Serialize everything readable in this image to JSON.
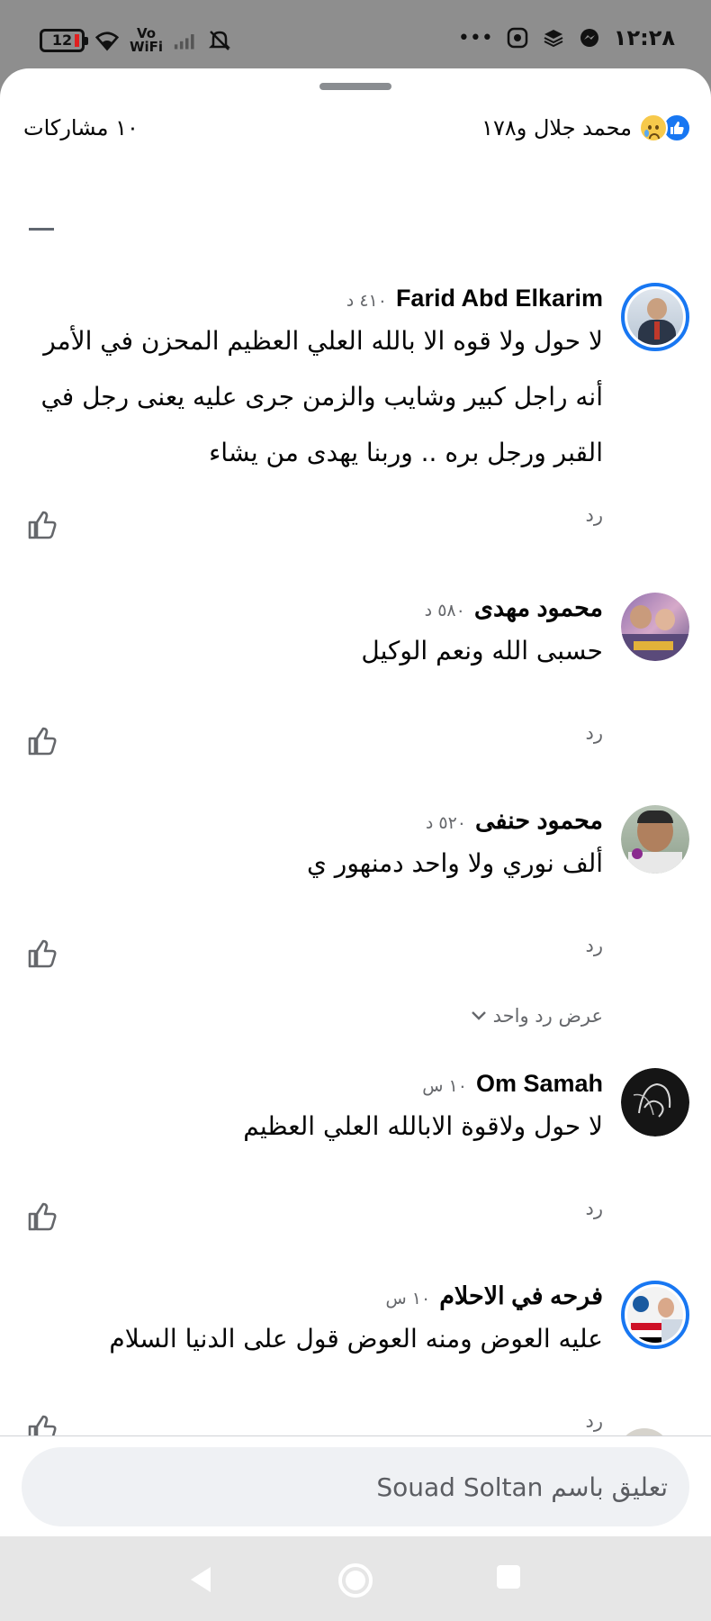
{
  "status_bar": {
    "battery": "12",
    "vowifi": [
      "Vo",
      "WiFi"
    ],
    "more": "•••",
    "time": "١٢:٢٨",
    "icons": [
      "battery-icon",
      "wifi-icon",
      "vowifi-icon",
      "signal-icon",
      "mute-icon",
      "shield-app-icon",
      "layers-icon",
      "messenger-icon"
    ]
  },
  "header": {
    "reaction_icons": [
      "like-icon",
      "sad-icon"
    ],
    "reaction_summary": "محمد جلال و١٧٨",
    "shares": "١٠ مشاركات"
  },
  "comments": [
    {
      "author": "Farid Abd Elkarim",
      "time": "٤١٠ د",
      "text": "لا حول ولا قوه الا بالله العلي العظيم المحزن في الأمر أنه راجل كبير وشايب والزمن جرى عليه يعنى رجل في القبر ورجل بره .. وربنا يهدى من يشاء",
      "reply_label": "رد"
    },
    {
      "author": "محمود مهدى",
      "time": "٥٨٠ د",
      "text": "حسبى الله ونعم الوكيل",
      "reply_label": "رد"
    },
    {
      "author": "محمود حنفى",
      "time": "٥٢٠ د",
      "text": "ألف نوري ولا واحد دمنهور ي",
      "reply_label": "رد"
    },
    {
      "author": "Om Samah",
      "time": "١٠ س",
      "text": "لا حول ولاقوة الابالله العلي العظيم",
      "reply_label": "رد"
    },
    {
      "author": "فرحه في الاحلام",
      "time": "١٠ س",
      "text": "عليه العوض ومنه العوض قول على الدنيا السلام",
      "reply_label": "رد"
    }
  ],
  "view_replies": "عرض رد واحد",
  "composer": {
    "placeholder": "تعليق باسم Souad Soltan"
  },
  "nav": [
    "back-icon",
    "home-icon",
    "recents-icon"
  ],
  "colors": {
    "accent": "#1877f2",
    "secondary_text": "#65676b",
    "status_bar_bg": "#8e8e8e"
  }
}
